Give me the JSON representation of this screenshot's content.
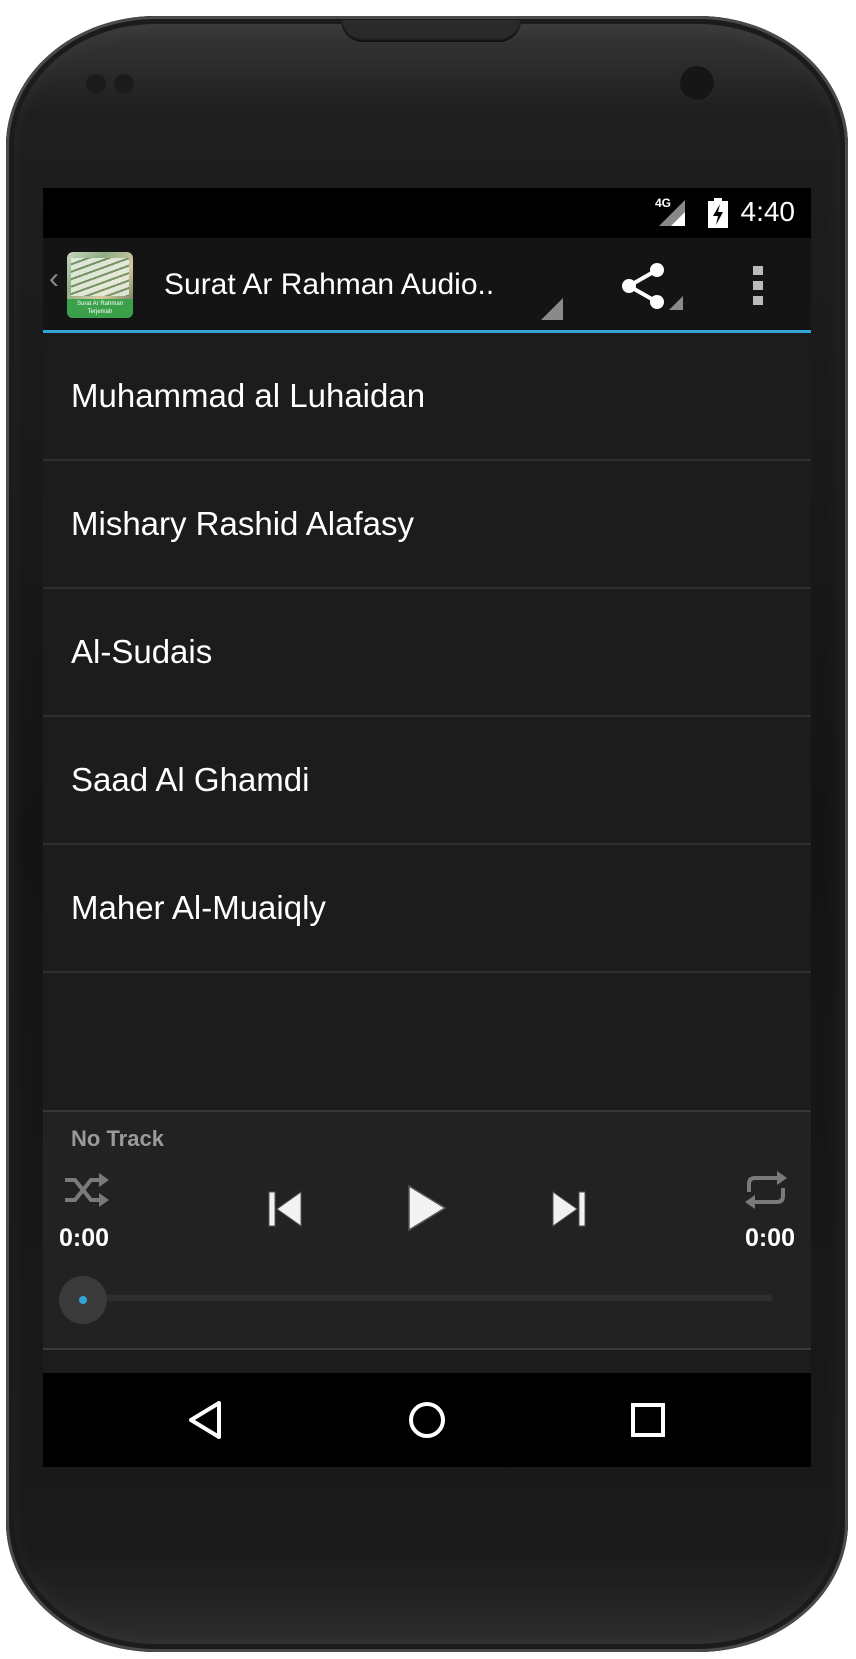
{
  "status_bar": {
    "network": "4G",
    "time": "4:40"
  },
  "action_bar": {
    "app_icon_text": "Surat Ar Rahman Terjemah",
    "title": "Surat Ar Rahman Audio.."
  },
  "reciters": [
    {
      "label": "Muhammad al Luhaidan"
    },
    {
      "label": "Mishary Rashid Alafasy"
    },
    {
      "label": "Al-Sudais"
    },
    {
      "label": "Saad Al Ghamdi"
    },
    {
      "label": "Maher Al-Muaiqly"
    }
  ],
  "player": {
    "track_name": "No Track",
    "elapsed": "0:00",
    "duration": "0:00",
    "progress": 0
  },
  "colors": {
    "accent": "#33a5d9",
    "background": "#1c1c1c"
  }
}
